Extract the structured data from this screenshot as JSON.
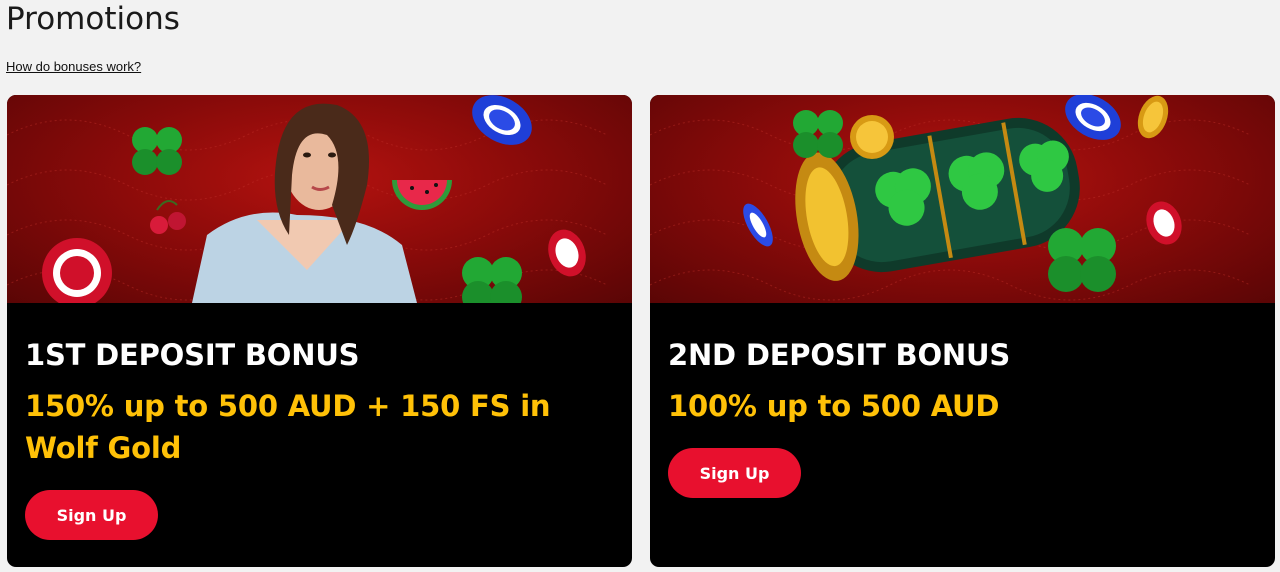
{
  "page": {
    "title": "Promotions",
    "help_link": "How do bonuses work?"
  },
  "cards": [
    {
      "title": "1ST DEPOSIT BONUS",
      "offer": "150% up to 500 AUD + 150 FS in Wolf Gold",
      "button": "Sign Up",
      "banner_icons": [
        "woman-illustration",
        "clover-icon",
        "cherries-icon",
        "watermelon-icon",
        "poker-chip-icon"
      ]
    },
    {
      "title": "2ND DEPOSIT BONUS",
      "offer": "100% up to 500 AUD",
      "button": "Sign Up",
      "banner_icons": [
        "slot-reel-illustration",
        "clover-icon",
        "gold-coin-icon",
        "poker-chip-icon"
      ]
    }
  ],
  "colors": {
    "background": "#f2f2f2",
    "card_bg": "#000000",
    "banner_red": "#8c0b0a",
    "offer_yellow": "#ffc107",
    "button_red": "#e8102e"
  }
}
